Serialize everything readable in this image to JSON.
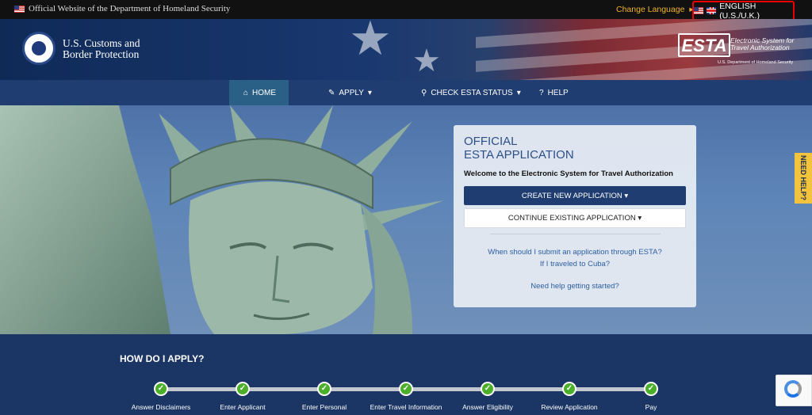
{
  "topbar": {
    "official_text": "Official Website of the Department of Homeland Security",
    "change_language": "Change Language",
    "current_language": "ENGLISH (U.S./U.K.)"
  },
  "header": {
    "agency_line1": "U.S. Customs and",
    "agency_line2": "Border Protection",
    "esta_mark": "ESTA",
    "esta_line1": "Electronic System for",
    "esta_line2": "Travel Authorization",
    "esta_dept": "U.S. Department of Homeland Security"
  },
  "nav": {
    "items": [
      {
        "label": "HOME",
        "icon": "home-icon",
        "active": true
      },
      {
        "label": "APPLY",
        "icon": "pencil-icon",
        "caret": true
      },
      {
        "label": "CHECK ESTA STATUS",
        "icon": "search-icon",
        "caret": true
      },
      {
        "label": "HELP",
        "icon": "question-icon"
      }
    ]
  },
  "panel": {
    "title_line1": "OFFICIAL",
    "title_line2": "ESTA APPLICATION",
    "welcome": "Welcome to the Electronic System for Travel Authorization",
    "create_button": "CREATE NEW APPLICATION",
    "continue_button": "CONTINUE EXISTING APPLICATION",
    "link1": "When should I submit an application through ESTA?",
    "link2": "If I traveled to Cuba?",
    "link3": "Need help getting started?"
  },
  "need_help": "NEED HELP?",
  "how": {
    "title": "HOW DO I APPLY?",
    "steps": [
      "Answer Disclaimers",
      "Enter Applicant",
      "Enter Personal",
      "Enter Travel Information",
      "Answer Eligibility",
      "Review Application",
      "Pay"
    ]
  },
  "colors": {
    "nav_bg": "#1f3d70",
    "nav_active": "#2b6086",
    "check_green": "#4caf2a",
    "change_language": "#f0b429",
    "highlight_border": "#ee0000"
  }
}
